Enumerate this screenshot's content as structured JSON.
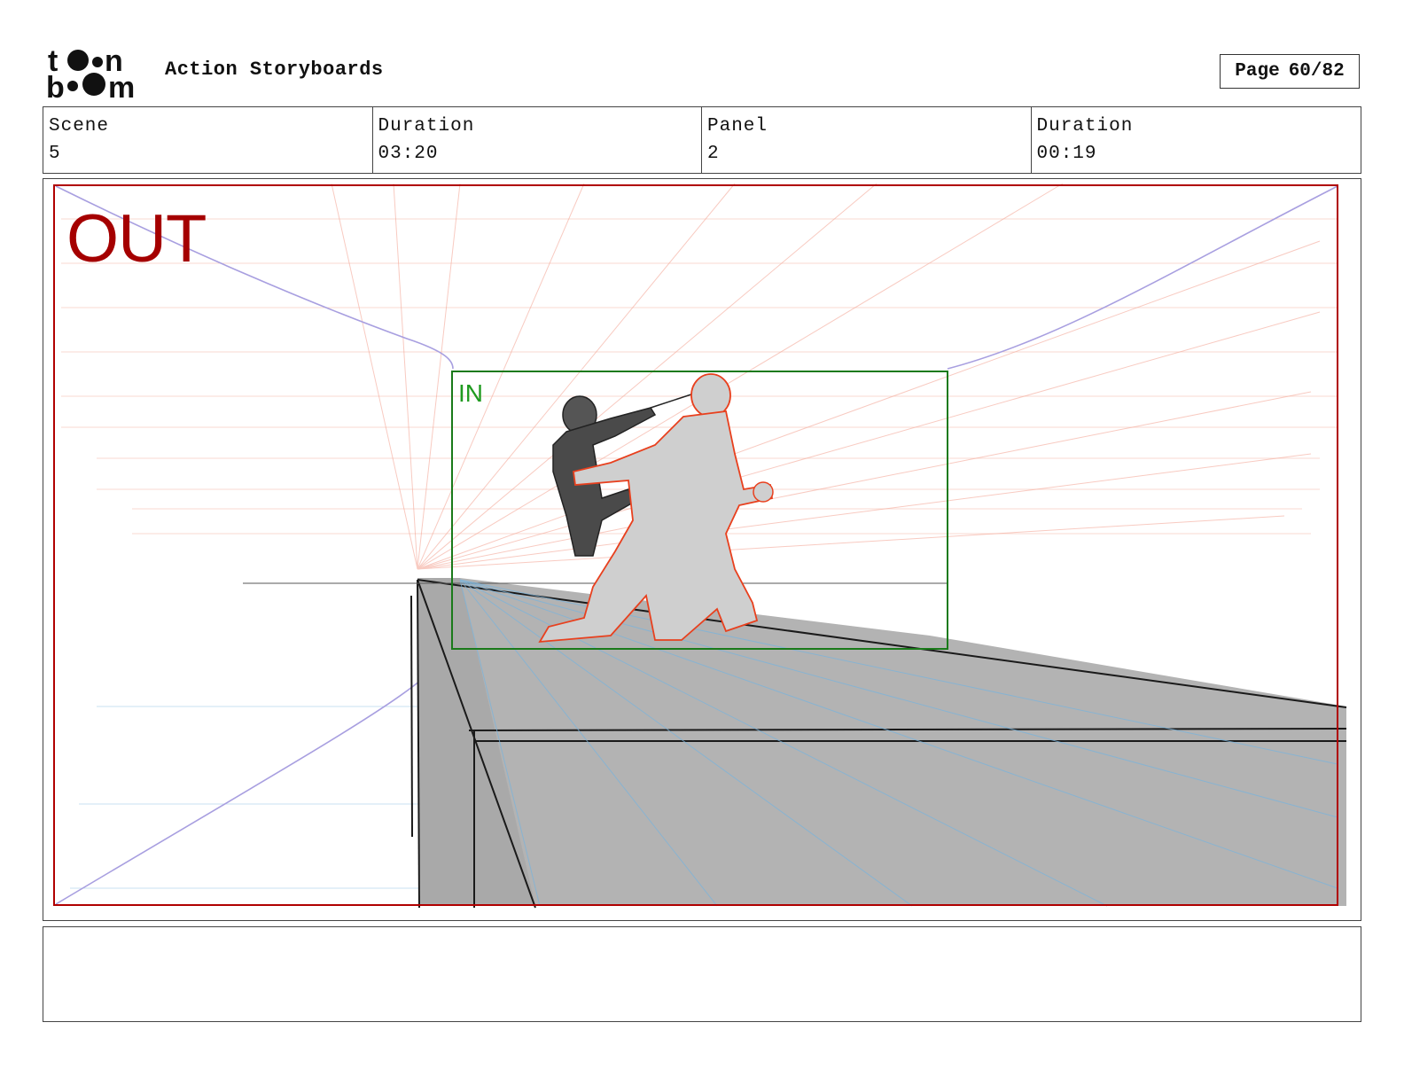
{
  "header": {
    "logo_text": [
      "t",
      "n",
      "b",
      "m"
    ],
    "title": "Action Storyboards",
    "page_label": "Page",
    "page_value": "60/82"
  },
  "info": {
    "scene_label": "Scene",
    "scene_value": "5",
    "scene_duration_label": "Duration",
    "scene_duration_value": "03:20",
    "panel_label": "Panel",
    "panel_value": "2",
    "panel_duration_label": "Duration",
    "panel_duration_value": "00:19"
  },
  "panel": {
    "out_label": "OUT",
    "in_label": "IN",
    "colors": {
      "out_frame": "#b00000",
      "in_frame": "#1a7a1a",
      "ground_fill": "#b3b3b3",
      "sketch_red": "#e8401e",
      "guide_red": "#f4b0a0",
      "guide_blue": "#7ab4dc",
      "camera_path": "#9b8fd8"
    }
  },
  "caption": {
    "text": ""
  }
}
